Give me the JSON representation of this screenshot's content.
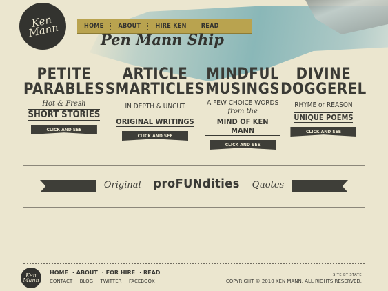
{
  "logo": {
    "line1": "Ken",
    "line2": "Mann"
  },
  "nav": [
    "HOME",
    "ABOUT",
    "HIRE KEN",
    "READ"
  ],
  "tagline": "Pen Mann Ship",
  "columns": [
    {
      "big1": "PETITE",
      "big2": "PARABLES",
      "script": "Hot & Fresh",
      "sub": "SHORT STORIES",
      "button": "CLICK AND SEE"
    },
    {
      "big1": "ARTICLE",
      "big2": "SMARTICLES",
      "mid": "IN DEPTH  &  UNCUT",
      "sub": "ORIGINAL WRITINGS",
      "button": "CLICK AND SEE"
    },
    {
      "big1": "MINDFUL",
      "big2": "MUSINGS",
      "mid": "A FEW CHOICE WORDS",
      "script": "from the",
      "sub": "MIND OF KEN MANN",
      "button": "CLICK AND SEE"
    },
    {
      "big1": "DIVINE",
      "big2": "DOGGEREL",
      "mid": "RHYME or REASON",
      "sub": "UNIQUE POEMS",
      "button": "CLICK AND SEE"
    }
  ],
  "banner": {
    "left": "Original",
    "main": "proFUNdities",
    "right": "Quotes"
  },
  "footer": {
    "nav": [
      "HOME",
      "ABOUT",
      "FOR HIRE",
      "READ"
    ],
    "subnav": [
      "CONTACT",
      "BLOG",
      "TWITTER",
      "FACEBOOK"
    ],
    "site_by": "SITE BY STATE",
    "copyright": "COPYRIGHT © 2010 KEN MANN. ALL RIGHTS RESERVED."
  }
}
